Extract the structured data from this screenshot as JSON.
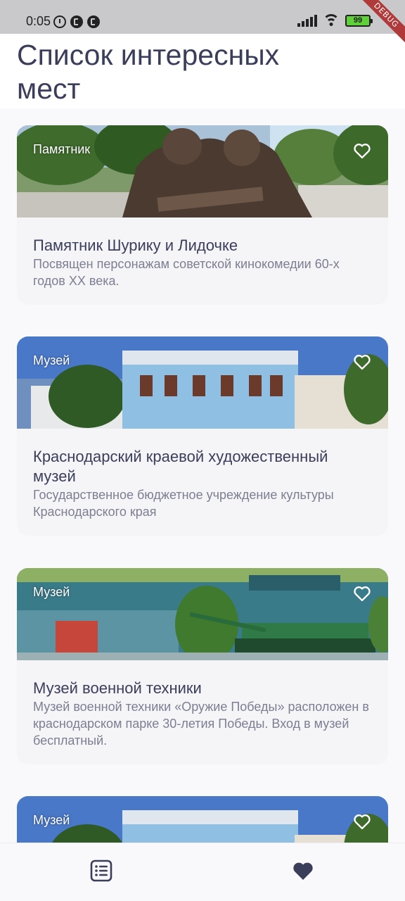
{
  "status_bar": {
    "time": "0:05",
    "battery": "99",
    "debug_label": "DEBUG"
  },
  "header": {
    "title": "Список интересных мест"
  },
  "places": [
    {
      "type": "Памятник",
      "title": "Памятник Шурику и Лидочке",
      "description": "Посвящен персонажам советской кинокомедии 60-х годов XX века."
    },
    {
      "type": "Музей",
      "title": "Краснодарский краевой художественный музей",
      "description": "Государственное бюджетное учреждение культуры Краснодарского края"
    },
    {
      "type": "Музей",
      "title": "Музей военной техники",
      "description": "Музей военной техники «Оружие Победы» расположен в краснодарском парке 30-летия Победы. Вход в музей бесплатный."
    },
    {
      "type": "Музей",
      "title": "",
      "description": ""
    }
  ],
  "bottom_nav": {
    "items": [
      {
        "icon": "list-icon",
        "active": false
      },
      {
        "icon": "heart-icon",
        "active": true
      }
    ]
  },
  "colors": {
    "primary_text": "#3b3e5b",
    "secondary_text": "#7c7e92",
    "card_bg": "#f5f5f7",
    "debug_banner": "#b0393a"
  }
}
